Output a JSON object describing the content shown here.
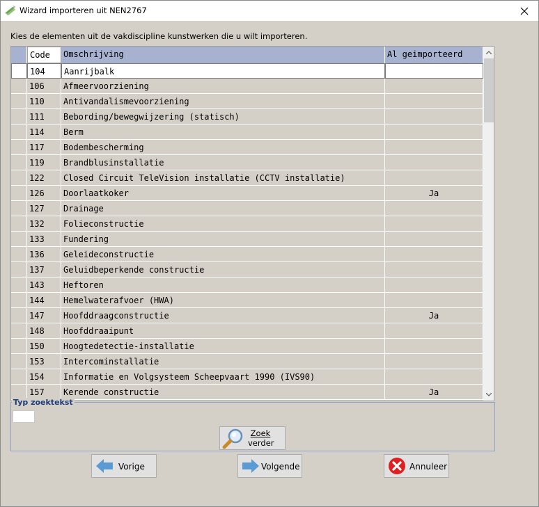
{
  "window": {
    "title": "Wizard importeren uit NEN2767",
    "close_glyph": "✕"
  },
  "instruction": "Kies de elementen uit de vakdiscipline kunstwerken die u wilt importeren.",
  "grid": {
    "columns": {
      "code": "Code",
      "description": "Omschrijving",
      "imported": "Al geimporteerd"
    },
    "rows": [
      {
        "code": "104",
        "description": "Aanrijbalk",
        "imported": ""
      },
      {
        "code": "106",
        "description": "Afmeervoorziening",
        "imported": ""
      },
      {
        "code": "110",
        "description": "Antivandalismevoorziening",
        "imported": ""
      },
      {
        "code": "111",
        "description": "Bebording/bewegwijzering (statisch)",
        "imported": ""
      },
      {
        "code": "114",
        "description": "Berm",
        "imported": ""
      },
      {
        "code": "117",
        "description": "Bodembescherming",
        "imported": ""
      },
      {
        "code": "119",
        "description": "Brandblusinstallatie",
        "imported": ""
      },
      {
        "code": "122",
        "description": "Closed Circuit TeleVision installatie (CCTV installatie)",
        "imported": ""
      },
      {
        "code": "126",
        "description": "Doorlaatkoker",
        "imported": "Ja"
      },
      {
        "code": "127",
        "description": "Drainage",
        "imported": ""
      },
      {
        "code": "132",
        "description": "Folieconstructie",
        "imported": ""
      },
      {
        "code": "133",
        "description": "Fundering",
        "imported": ""
      },
      {
        "code": "136",
        "description": "Geleideconstructie",
        "imported": ""
      },
      {
        "code": "137",
        "description": "Geluidbeperkende constructie",
        "imported": ""
      },
      {
        "code": "143",
        "description": "Heftoren",
        "imported": ""
      },
      {
        "code": "144",
        "description": "Hemelwaterafvoer (HWA)",
        "imported": ""
      },
      {
        "code": "147",
        "description": "Hoofddraagconstructie",
        "imported": "Ja"
      },
      {
        "code": "148",
        "description": "Hoofddraaipunt",
        "imported": ""
      },
      {
        "code": "150",
        "description": "Hoogtedetectie-installatie",
        "imported": ""
      },
      {
        "code": "153",
        "description": "Intercominstallatie",
        "imported": ""
      },
      {
        "code": "154",
        "description": "Informatie en Volgsysteem Scheepvaart 1990 (IVS90)",
        "imported": ""
      },
      {
        "code": "157",
        "description": "Kerende constructie",
        "imported": "Ja"
      }
    ]
  },
  "search": {
    "legend": "Typ zoektekst",
    "value": "",
    "zoek_label_line1": "Zoek",
    "zoek_label_line2": "verder"
  },
  "buttons": {
    "previous": "Vorige",
    "next": "Volgende",
    "cancel": "Annuleer"
  },
  "colors": {
    "header_bg": "#a6b2cf",
    "arrow_blue": "#4a90d9",
    "cancel_red": "#e02020"
  },
  "icons": {
    "app": "wizard-icon",
    "zoek": "magnifier-icon",
    "previous": "arrow-left-icon",
    "next": "arrow-right-icon",
    "cancel": "cancel-icon"
  }
}
